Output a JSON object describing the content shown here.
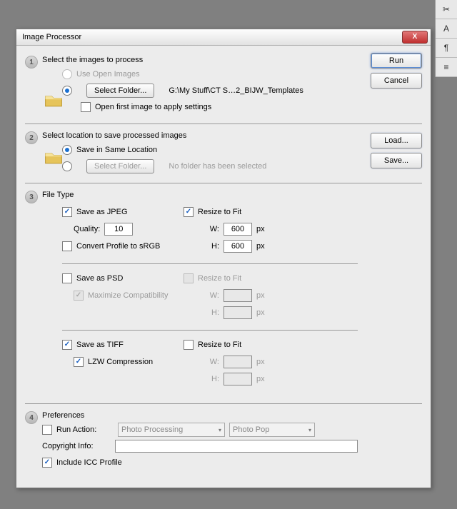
{
  "window": {
    "title": "Image Processor",
    "close": "X"
  },
  "buttons": {
    "run": "Run",
    "cancel": "Cancel",
    "load": "Load...",
    "save": "Save..."
  },
  "sec1": {
    "num": "1",
    "title": "Select the images to process",
    "use_open": "Use Open Images",
    "select_folder": "Select Folder...",
    "path": "G:\\My Stuff\\CT S…2_BIJW_Templates",
    "open_first": "Open first image to apply settings"
  },
  "sec2": {
    "num": "2",
    "title": "Select location to save processed images",
    "same_loc": "Save in Same Location",
    "select_folder": "Select Folder...",
    "no_folder": "No folder has been selected"
  },
  "sec3": {
    "num": "3",
    "title": "File Type",
    "jpeg": {
      "label": "Save as JPEG",
      "quality_label": "Quality:",
      "quality": "10",
      "convert": "Convert Profile to sRGB",
      "resize": "Resize to Fit",
      "w_label": "W:",
      "w": "600",
      "h_label": "H:",
      "h": "600",
      "px": "px"
    },
    "psd": {
      "label": "Save as PSD",
      "maxcompat": "Maximize Compatibility",
      "resize": "Resize to Fit",
      "w_label": "W:",
      "h_label": "H:",
      "px": "px"
    },
    "tiff": {
      "label": "Save as TIFF",
      "lzw": "LZW Compression",
      "resize": "Resize to Fit",
      "w_label": "W:",
      "h_label": "H:",
      "px": "px"
    }
  },
  "sec4": {
    "num": "4",
    "title": "Preferences",
    "run_action": "Run Action:",
    "action_set": "Photo Processing",
    "action": "Photo Pop",
    "copyright_label": "Copyright Info:",
    "copyright": "",
    "icc": "Include ICC Profile"
  },
  "tools": {
    "t1": "✂",
    "t2": "A",
    "t3": "¶",
    "t4": "≡"
  }
}
